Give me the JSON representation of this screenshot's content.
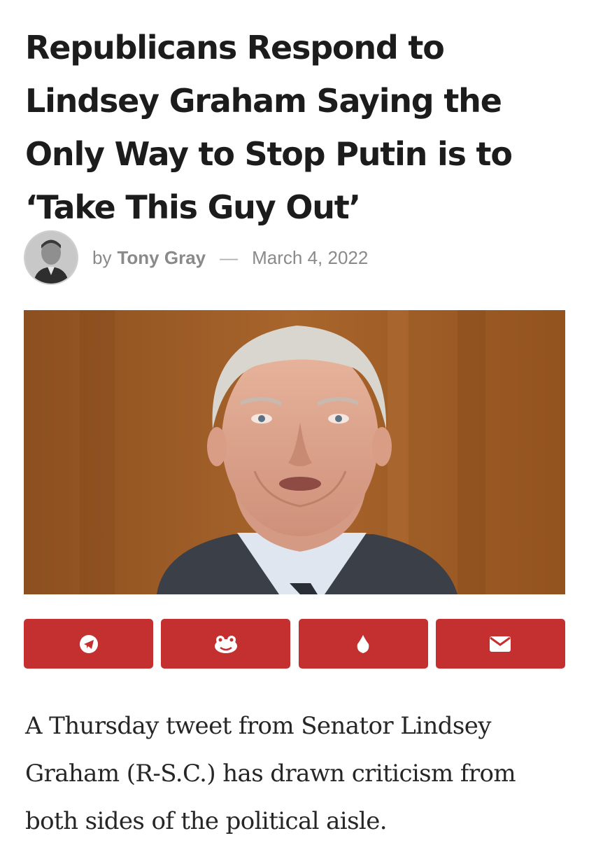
{
  "article": {
    "title": "Republicans Respond to Lindsey Graham Saying the Only Way to Stop Putin is to ‘Take This Guy Out’",
    "byline": {
      "prefix": "by",
      "author": "Tony Gray",
      "separator": "—",
      "date": "March 4, 2022"
    },
    "lead_paragraph": "A Thursday tweet from Senator Lindsey Graham (R-S.C.) has drawn criticism from both sides of the political aisle."
  },
  "share_buttons": [
    {
      "icon": "telegram-icon"
    },
    {
      "icon": "gettr-frog-icon"
    },
    {
      "icon": "flame-icon"
    },
    {
      "icon": "envelope-icon"
    }
  ],
  "colors": {
    "share_button": "#c43030",
    "headline": "#1c1c1c",
    "byline": "#8a8a8a",
    "body_text": "#262626"
  }
}
